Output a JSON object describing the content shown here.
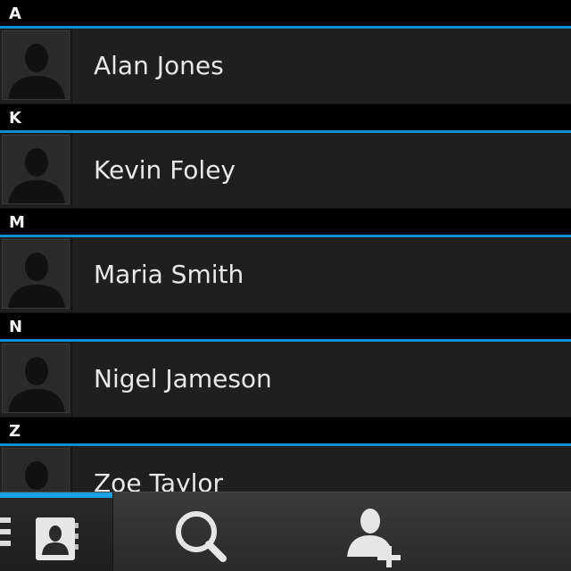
{
  "sections": [
    {
      "letter": "A",
      "contacts": [
        {
          "name": "Alan Jones"
        }
      ]
    },
    {
      "letter": "K",
      "contacts": [
        {
          "name": "Kevin Foley"
        }
      ]
    },
    {
      "letter": "M",
      "contacts": [
        {
          "name": "Maria Smith"
        }
      ]
    },
    {
      "letter": "N",
      "contacts": [
        {
          "name": "Nigel Jameson"
        }
      ]
    },
    {
      "letter": "Z",
      "contacts": [
        {
          "name": "Zoe Taylor"
        }
      ]
    }
  ],
  "actionbar": {
    "tabs": [
      {
        "icon": "contacts-book-icon",
        "active": true
      },
      {
        "icon": "search-icon",
        "active": false
      },
      {
        "icon": "add-contact-icon",
        "active": false
      }
    ],
    "menu_icon": "menu-icon"
  },
  "colors": {
    "accent": "#0f8fcf",
    "row_bg": "#1f1f1f",
    "header_bg": "#000000",
    "text": "#e8e8e8"
  }
}
